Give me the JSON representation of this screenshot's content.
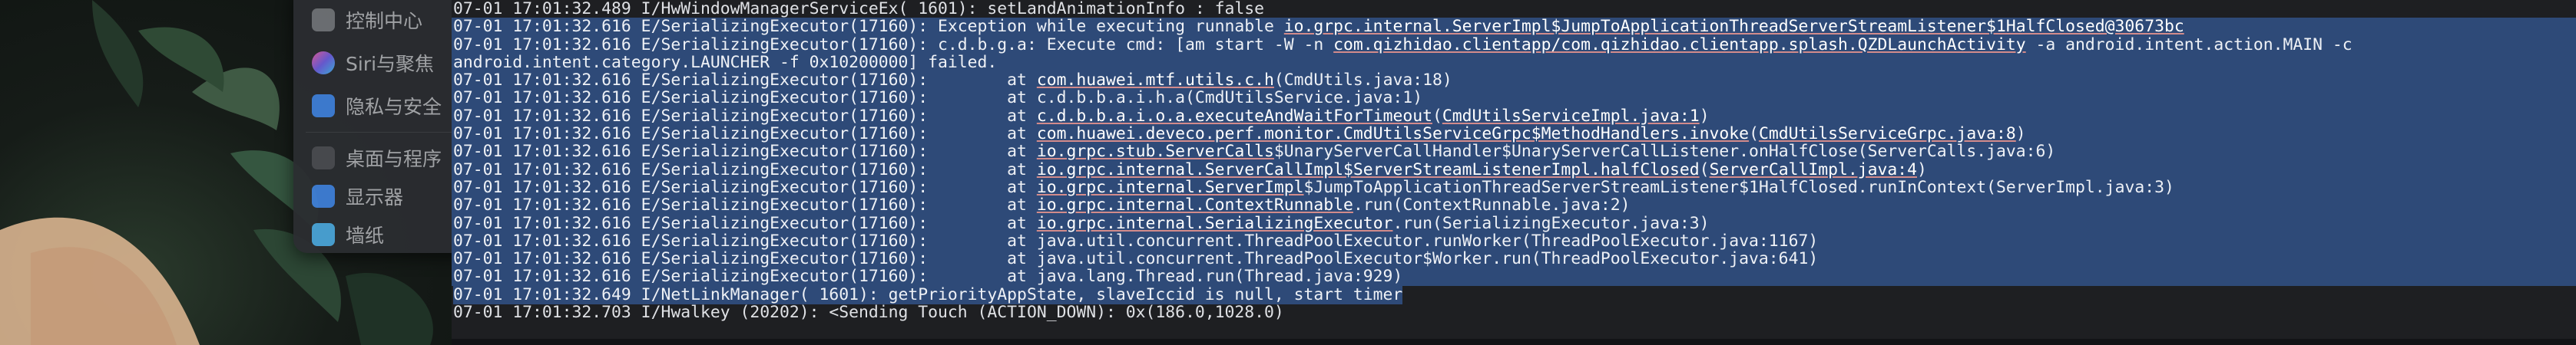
{
  "settings_sidebar": {
    "items": [
      {
        "label": "控制中心",
        "icon": "control-center-icon",
        "color": "#6f7276"
      },
      {
        "label": "Siri与聚焦",
        "icon": "siri-icon",
        "color": "#8a5cc6"
      },
      {
        "label": "隐私与安全",
        "icon": "privacy-hand-icon",
        "color": "#3f7fd6"
      },
      {
        "label": "桌面与程序",
        "icon": "desktop-dock-icon",
        "color": "#4a4c50"
      },
      {
        "label": "显示器",
        "icon": "display-icon",
        "color": "#3f7fd6"
      },
      {
        "label": "墙纸",
        "icon": "wallpaper-icon",
        "color": "#4aa3d6"
      }
    ]
  },
  "terminal": {
    "selection_color": "#2e4a78",
    "lines": [
      {
        "selected": false,
        "segments": [
          {
            "t": "07-01 17:01:32.489 I/HwWindowManagerServiceEx( 1601): setLandAnimationInfo : false"
          }
        ]
      },
      {
        "selected": true,
        "segments": [
          {
            "t": "07-01 17:01:32.616 E/SerializingExecutor(17160): Exception while executing runnable "
          },
          {
            "t": "io.grpc.internal.ServerImpl$JumpToApplicationThreadServerStreamListener$1HalfClosed@30673bc",
            "link": true
          }
        ]
      },
      {
        "selected": true,
        "segments": [
          {
            "t": "07-01 17:01:32.616 E/SerializingExecutor(17160): c.d.b.g.a: Execute cmd: [am start -W -n "
          },
          {
            "t": "com.qizhidao.clientapp/com.qizhidao.clientapp.splash.QZDLaunchActivity",
            "link": true
          },
          {
            "t": " -a android.intent.action.MAIN -c"
          }
        ]
      },
      {
        "selected": true,
        "segments": [
          {
            "t": "android.intent.category.LAUNCHER -f 0x10200000] failed."
          }
        ]
      },
      {
        "selected": true,
        "segments": [
          {
            "t": "07-01 17:01:32.616 E/SerializingExecutor(17160):        at "
          },
          {
            "t": "com.huawei.mtf.utils.c.h",
            "link": true
          },
          {
            "t": "(CmdUtils.java:18)"
          }
        ]
      },
      {
        "selected": true,
        "segments": [
          {
            "t": "07-01 17:01:32.616 E/SerializingExecutor(17160):        at c.d.b.b.a.i.h.a(CmdUtilsService.java:1)"
          }
        ]
      },
      {
        "selected": true,
        "segments": [
          {
            "t": "07-01 17:01:32.616 E/SerializingExecutor(17160):        at "
          },
          {
            "t": "c.d.b.b.a.i.o.a.executeAndWaitForTimeout",
            "link": true
          },
          {
            "t": "("
          },
          {
            "t": "CmdUtilsServiceImpl.java:1",
            "link": true
          },
          {
            "t": ")"
          }
        ]
      },
      {
        "selected": true,
        "segments": [
          {
            "t": "07-01 17:01:32.616 E/SerializingExecutor(17160):        at "
          },
          {
            "t": "com.huawei.deveco.perf.monitor.CmdUtilsServiceGrpc$MethodHandlers.invoke",
            "link": true
          },
          {
            "t": "("
          },
          {
            "t": "CmdUtilsServiceGrpc.java:8",
            "link": true
          },
          {
            "t": ")"
          }
        ]
      },
      {
        "selected": true,
        "segments": [
          {
            "t": "07-01 17:01:32.616 E/SerializingExecutor(17160):        at "
          },
          {
            "t": "io.grpc.stub.ServerCalls",
            "link": true
          },
          {
            "t": "$UnaryServerCallHandler$UnaryServerCallListener.onHalfClose(ServerCalls.java:6)"
          }
        ]
      },
      {
        "selected": true,
        "segments": [
          {
            "t": "07-01 17:01:32.616 E/SerializingExecutor(17160):        at "
          },
          {
            "t": "io.grpc.internal.ServerCallImpl$ServerStreamListenerImpl.halfClosed",
            "link": true
          },
          {
            "t": "("
          },
          {
            "t": "ServerCallImpl.java:4",
            "link": true
          },
          {
            "t": ")"
          }
        ]
      },
      {
        "selected": true,
        "segments": [
          {
            "t": "07-01 17:01:32.616 E/SerializingExecutor(17160):        at "
          },
          {
            "t": "io.grpc.internal.ServerImpl",
            "link": true
          },
          {
            "t": "$JumpToApplicationThreadServerStreamListener$1HalfClosed.runInContext(ServerImpl.java:3)"
          }
        ]
      },
      {
        "selected": true,
        "segments": [
          {
            "t": "07-01 17:01:32.616 E/SerializingExecutor(17160):        at "
          },
          {
            "t": "io.grpc.internal.ContextRunnable",
            "link": true
          },
          {
            "t": ".run(ContextRunnable.java:2)"
          }
        ]
      },
      {
        "selected": true,
        "segments": [
          {
            "t": "07-01 17:01:32.616 E/SerializingExecutor(17160):        at "
          },
          {
            "t": "io.grpc.internal.SerializingExecutor",
            "link": true
          },
          {
            "t": ".run(SerializingExecutor.java:3)"
          }
        ]
      },
      {
        "selected": true,
        "segments": [
          {
            "t": "07-01 17:01:32.616 E/SerializingExecutor(17160):        at java.util.concurrent.ThreadPoolExecutor.runWorker(ThreadPoolExecutor.java:1167)"
          }
        ]
      },
      {
        "selected": true,
        "segments": [
          {
            "t": "07-01 17:01:32.616 E/SerializingExecutor(17160):        at java.util.concurrent.ThreadPoolExecutor$Worker.run(ThreadPoolExecutor.java:641)"
          }
        ]
      },
      {
        "selected": true,
        "segments": [
          {
            "t": "07-01 17:01:32.616 E/SerializingExecutor(17160):        at java.lang.Thread.run(Thread.java:929)"
          }
        ]
      },
      {
        "selected": "partial",
        "segments": [
          {
            "t": "07-01 17:01:32.649 I/NetLinkManager( 1601): getPriorityAppState, slaveIccid is null, start timer",
            "sel": true
          }
        ]
      },
      {
        "selected": false,
        "segments": [
          {
            "t": "07-01 17:01:32.703 I/Hwalkey (20202): <Sending Touch (ACTION_DOWN): 0x(186.0,1028.0)"
          }
        ]
      }
    ]
  }
}
